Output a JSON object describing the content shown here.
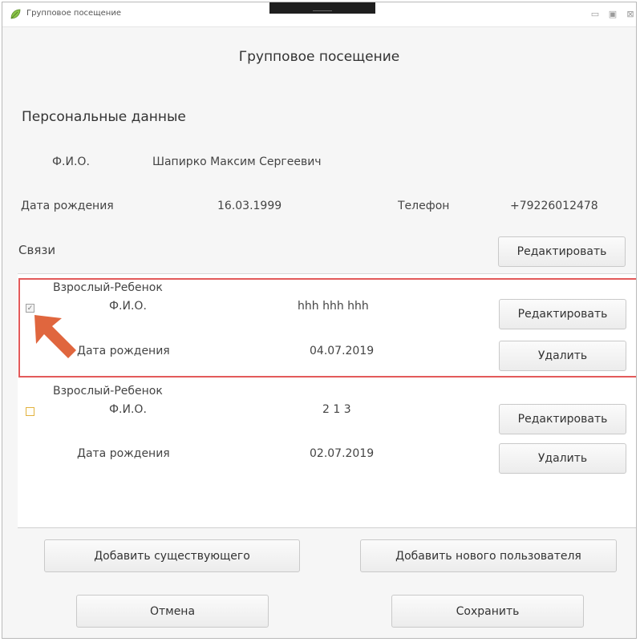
{
  "window": {
    "title": "Групповое посещение",
    "controls": {
      "minimize": "▭",
      "maximize": "▣",
      "close": "⊠"
    }
  },
  "dialog": {
    "title": "Групповое посещение"
  },
  "personal": {
    "section_title": "Персональные данные",
    "fio_label": "Ф.И.О.",
    "fio_value": "Шапирко Максим Сергеевич",
    "birth_label": "Дата рождения",
    "birth_value": "16.03.1999",
    "phone_label": "Телефон",
    "phone_value": "+79226012478"
  },
  "links": {
    "section_title": "Связи",
    "edit_label": "Редактировать",
    "items": [
      {
        "type": "Взрослый-Ребенок",
        "checked": true,
        "fio_label": "Ф.И.О.",
        "fio_value": "hhh hhh hhh",
        "birth_label": "Дата рождения",
        "birth_value": "04.07.2019",
        "edit_label": "Редактировать",
        "delete_label": "Удалить"
      },
      {
        "type": "Взрослый-Ребенок",
        "checked": false,
        "fio_label": "Ф.И.О.",
        "fio_value": "2 1 3",
        "birth_label": "Дата рождения",
        "birth_value": "02.07.2019",
        "edit_label": "Редактировать",
        "delete_label": "Удалить"
      }
    ]
  },
  "actions": {
    "add_existing": "Добавить существующего",
    "add_new_user": "Добавить нового пользователя",
    "cancel": "Отмена",
    "save": "Сохранить"
  },
  "colors": {
    "highlight": "#e35a5a",
    "arrow": "#e0663e"
  }
}
